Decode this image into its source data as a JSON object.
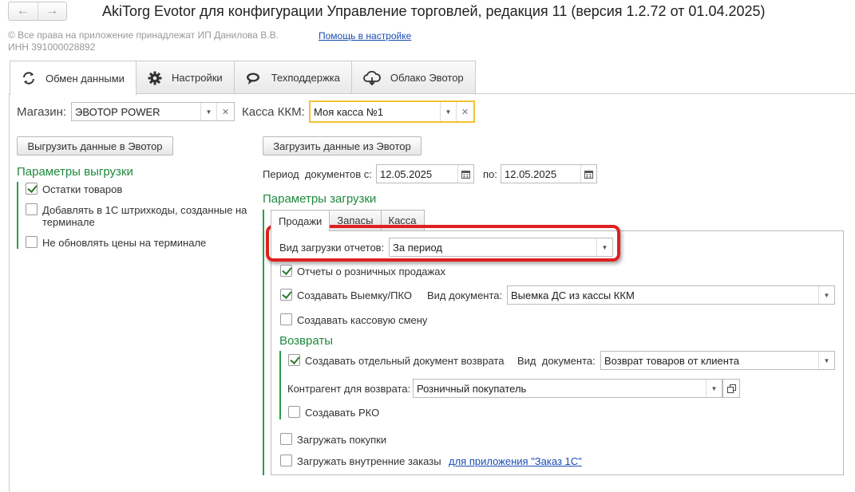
{
  "window": {
    "title": "AkiTorg Evotor для конфигурации Управление торговлей, редакция 11 (версия 1.2.72 от 01.04.2025)",
    "back_icon": "arrow-left-icon",
    "forward_icon": "arrow-right-icon"
  },
  "header": {
    "copyright": "© Все права на приложение принадлежат ИП Данилова В.В.",
    "inn": "ИНН 391000028892",
    "help_link": "Помощь в настройке"
  },
  "tabs": [
    {
      "label": "Обмен данными",
      "icon": "sync-icon"
    },
    {
      "label": "Настройки",
      "icon": "gear-icon"
    },
    {
      "label": "Техподдержка",
      "icon": "chat-icon"
    },
    {
      "label": "Облако Эвотор",
      "icon": "cloud-icon"
    }
  ],
  "store": {
    "label": "Магазин:",
    "value": "ЭВОТОР POWER"
  },
  "kkm": {
    "label": "Касса ККМ:",
    "value": "Моя касса №1"
  },
  "export": {
    "button": "Выгрузить данные в Эвотор",
    "section_title": "Параметры выгрузки",
    "options": [
      {
        "label": "Остатки товаров",
        "checked": true
      },
      {
        "label": "Добавлять в 1С штрихкоды, созданные на терминале",
        "checked": false
      },
      {
        "label": "Не обновлять цены на терминале",
        "checked": false
      }
    ]
  },
  "import": {
    "button": "Загрузить данные из Эвотор",
    "period_label": "Период  документов с:",
    "date_from": "12.05.2025",
    "to_label": "по:",
    "date_to": "12.05.2025",
    "section_title": "Параметры загрузки",
    "subtabs": [
      "Продажи",
      "Запасы",
      "Касса"
    ],
    "report_mode_label": "Вид загрузки отчетов:",
    "report_mode_value": "За период",
    "retail_reports": {
      "label": "Отчеты о розничных продажах",
      "checked": true
    },
    "withdrawal": {
      "label": "Создавать Выемку/ПКО",
      "checked": true
    },
    "doc_type_label": "Вид документа:",
    "doc_type_value": "Выемка ДС из кассы ККМ",
    "cash_shift": {
      "label": "Создавать кассовую смену",
      "checked": false
    },
    "returns_title": "Возвраты",
    "separate_return": {
      "label": "Создавать отдельный документ возврата",
      "checked": true
    },
    "return_doc_type_label": "Вид  документа:",
    "return_doc_type_value": "Возврат товаров от клиента",
    "counterparty_label": "Контрагент для возврата:",
    "counterparty_value": "Розничный покупатель",
    "create_rko": {
      "label": "Создавать РКО",
      "checked": false
    },
    "load_purchases": {
      "label": "Загружать покупки",
      "checked": false
    },
    "load_orders": {
      "label": "Загружать внутренние заказы",
      "checked": false
    },
    "orders_link": "для приложения \"Заказ 1С\""
  },
  "colors": {
    "accent_green": "#1e8a3c",
    "highlight_red": "#e02020",
    "focus_yellow": "#f2c230",
    "link_blue": "#1a4db5"
  }
}
